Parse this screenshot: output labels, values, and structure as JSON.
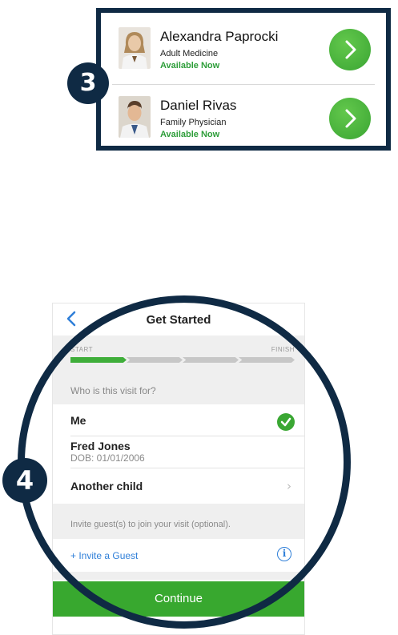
{
  "step3": {
    "badge": "3",
    "doctors": [
      {
        "name": "Alexandra Paprocki",
        "specialty": "Adult Medicine",
        "status": "Available Now"
      },
      {
        "name": "Daniel Rivas",
        "specialty": "Family Physician",
        "status": "Available Now"
      }
    ]
  },
  "step4": {
    "badge": "4",
    "nav": {
      "title": "Get Started"
    },
    "progress": {
      "start": "START",
      "finish": "FINISH",
      "steps_total": 4,
      "steps_completed": 1
    },
    "question": "Who is this visit for?",
    "options": [
      {
        "label": "Me",
        "selected": true
      },
      {
        "label": "Fred Jones",
        "sub": "DOB: 01/01/2006"
      },
      {
        "label": "Another child"
      }
    ],
    "invite_prompt": "Invite guest(s) to join your visit (optional).",
    "invite_link": "+ Invite a Guest",
    "info_icon": "i",
    "continue_label": "Continue"
  },
  "colors": {
    "navy": "#0f2a44",
    "green": "#3aa733",
    "link_blue": "#2f7fd8"
  }
}
